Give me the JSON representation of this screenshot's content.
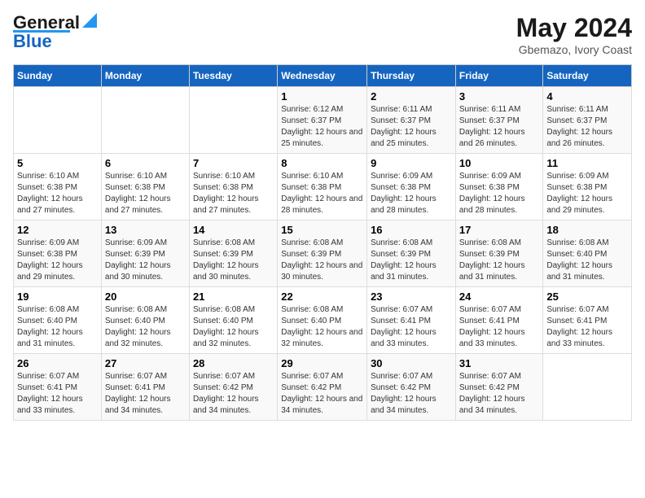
{
  "logo": {
    "line1": "General",
    "line2": "Blue"
  },
  "title": "May 2024",
  "subtitle": "Gbemazo, Ivory Coast",
  "columns": [
    "Sunday",
    "Monday",
    "Tuesday",
    "Wednesday",
    "Thursday",
    "Friday",
    "Saturday"
  ],
  "weeks": [
    [
      {
        "day": "",
        "sunrise": "",
        "sunset": "",
        "daylight": ""
      },
      {
        "day": "",
        "sunrise": "",
        "sunset": "",
        "daylight": ""
      },
      {
        "day": "",
        "sunrise": "",
        "sunset": "",
        "daylight": ""
      },
      {
        "day": "1",
        "sunrise": "6:12 AM",
        "sunset": "6:37 PM",
        "daylight": "12 hours and 25 minutes."
      },
      {
        "day": "2",
        "sunrise": "6:11 AM",
        "sunset": "6:37 PM",
        "daylight": "12 hours and 25 minutes."
      },
      {
        "day": "3",
        "sunrise": "6:11 AM",
        "sunset": "6:37 PM",
        "daylight": "12 hours and 26 minutes."
      },
      {
        "day": "4",
        "sunrise": "6:11 AM",
        "sunset": "6:37 PM",
        "daylight": "12 hours and 26 minutes."
      }
    ],
    [
      {
        "day": "5",
        "sunrise": "6:10 AM",
        "sunset": "6:38 PM",
        "daylight": "12 hours and 27 minutes."
      },
      {
        "day": "6",
        "sunrise": "6:10 AM",
        "sunset": "6:38 PM",
        "daylight": "12 hours and 27 minutes."
      },
      {
        "day": "7",
        "sunrise": "6:10 AM",
        "sunset": "6:38 PM",
        "daylight": "12 hours and 27 minutes."
      },
      {
        "day": "8",
        "sunrise": "6:10 AM",
        "sunset": "6:38 PM",
        "daylight": "12 hours and 28 minutes."
      },
      {
        "day": "9",
        "sunrise": "6:09 AM",
        "sunset": "6:38 PM",
        "daylight": "12 hours and 28 minutes."
      },
      {
        "day": "10",
        "sunrise": "6:09 AM",
        "sunset": "6:38 PM",
        "daylight": "12 hours and 28 minutes."
      },
      {
        "day": "11",
        "sunrise": "6:09 AM",
        "sunset": "6:38 PM",
        "daylight": "12 hours and 29 minutes."
      }
    ],
    [
      {
        "day": "12",
        "sunrise": "6:09 AM",
        "sunset": "6:38 PM",
        "daylight": "12 hours and 29 minutes."
      },
      {
        "day": "13",
        "sunrise": "6:09 AM",
        "sunset": "6:39 PM",
        "daylight": "12 hours and 30 minutes."
      },
      {
        "day": "14",
        "sunrise": "6:08 AM",
        "sunset": "6:39 PM",
        "daylight": "12 hours and 30 minutes."
      },
      {
        "day": "15",
        "sunrise": "6:08 AM",
        "sunset": "6:39 PM",
        "daylight": "12 hours and 30 minutes."
      },
      {
        "day": "16",
        "sunrise": "6:08 AM",
        "sunset": "6:39 PM",
        "daylight": "12 hours and 31 minutes."
      },
      {
        "day": "17",
        "sunrise": "6:08 AM",
        "sunset": "6:39 PM",
        "daylight": "12 hours and 31 minutes."
      },
      {
        "day": "18",
        "sunrise": "6:08 AM",
        "sunset": "6:40 PM",
        "daylight": "12 hours and 31 minutes."
      }
    ],
    [
      {
        "day": "19",
        "sunrise": "6:08 AM",
        "sunset": "6:40 PM",
        "daylight": "12 hours and 31 minutes."
      },
      {
        "day": "20",
        "sunrise": "6:08 AM",
        "sunset": "6:40 PM",
        "daylight": "12 hours and 32 minutes."
      },
      {
        "day": "21",
        "sunrise": "6:08 AM",
        "sunset": "6:40 PM",
        "daylight": "12 hours and 32 minutes."
      },
      {
        "day": "22",
        "sunrise": "6:08 AM",
        "sunset": "6:40 PM",
        "daylight": "12 hours and 32 minutes."
      },
      {
        "day": "23",
        "sunrise": "6:07 AM",
        "sunset": "6:41 PM",
        "daylight": "12 hours and 33 minutes."
      },
      {
        "day": "24",
        "sunrise": "6:07 AM",
        "sunset": "6:41 PM",
        "daylight": "12 hours and 33 minutes."
      },
      {
        "day": "25",
        "sunrise": "6:07 AM",
        "sunset": "6:41 PM",
        "daylight": "12 hours and 33 minutes."
      }
    ],
    [
      {
        "day": "26",
        "sunrise": "6:07 AM",
        "sunset": "6:41 PM",
        "daylight": "12 hours and 33 minutes."
      },
      {
        "day": "27",
        "sunrise": "6:07 AM",
        "sunset": "6:41 PM",
        "daylight": "12 hours and 34 minutes."
      },
      {
        "day": "28",
        "sunrise": "6:07 AM",
        "sunset": "6:42 PM",
        "daylight": "12 hours and 34 minutes."
      },
      {
        "day": "29",
        "sunrise": "6:07 AM",
        "sunset": "6:42 PM",
        "daylight": "12 hours and 34 minutes."
      },
      {
        "day": "30",
        "sunrise": "6:07 AM",
        "sunset": "6:42 PM",
        "daylight": "12 hours and 34 minutes."
      },
      {
        "day": "31",
        "sunrise": "6:07 AM",
        "sunset": "6:42 PM",
        "daylight": "12 hours and 34 minutes."
      },
      {
        "day": "",
        "sunrise": "",
        "sunset": "",
        "daylight": ""
      }
    ]
  ],
  "labels": {
    "sunrise_prefix": "Sunrise: ",
    "sunset_prefix": "Sunset: ",
    "daylight_prefix": "Daylight: "
  }
}
